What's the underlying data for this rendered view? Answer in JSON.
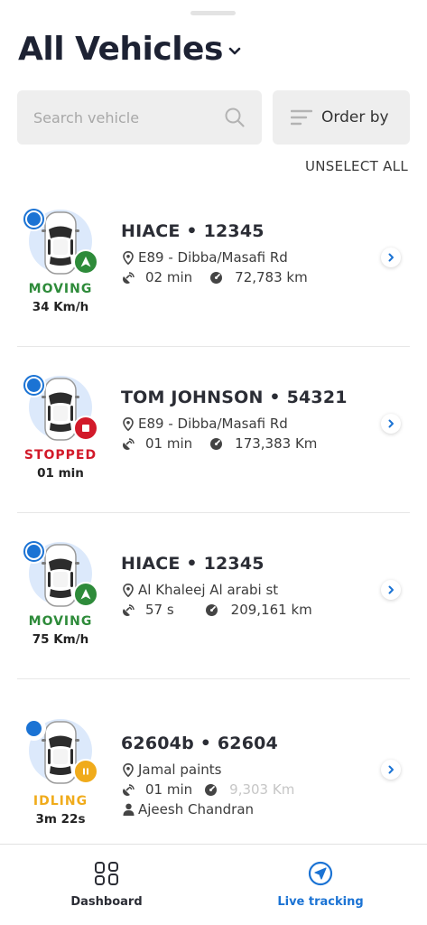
{
  "header": {
    "title": "All Vehicles"
  },
  "search": {
    "placeholder": "Search vehicle"
  },
  "order": {
    "label": "Order by"
  },
  "unselect_all": "UNSELECT ALL",
  "colors": {
    "accent": "#1b73d4",
    "moving": "#2e8b3a",
    "stopped": "#d21a2a",
    "idling": "#f0ab1b",
    "avatar_bg": "#dce9fb"
  },
  "vehicles": [
    {
      "name": "HIACE • 12345",
      "location": "E89 - Dibba/Masafi Rd",
      "update_time": "02 min",
      "odometer": "72,783 km",
      "status": "MOVING",
      "status_detail": "34 Km/h",
      "status_icon": "navigation-arrow-icon",
      "selected": true
    },
    {
      "name": "TOM JOHNSON • 54321",
      "location": "E89 - Dibba/Masafi Rd",
      "update_time": "01 min",
      "odometer": "173,383 Km",
      "status": "STOPPED",
      "status_detail": "01 min",
      "status_icon": "stop-square-icon",
      "selected": true
    },
    {
      "name": "HIACE • 12345",
      "location": "Al Khaleej Al arabi st",
      "update_time": "57 s",
      "odometer": "209,161 km",
      "status": "MOVING",
      "status_detail": "75 Km/h",
      "status_icon": "navigation-arrow-icon",
      "selected": true
    },
    {
      "name": "62604b • 62604",
      "location": "Jamal paints",
      "update_time": "01 min",
      "odometer": "9,303 Km",
      "driver": "Ajeesh Chandran",
      "status": "IDLING",
      "status_detail": "3m 22s",
      "status_icon": "pause-icon",
      "selected": true
    }
  ],
  "bottom_nav": {
    "dashboard": "Dashboard",
    "live_tracking": "Live tracking"
  }
}
